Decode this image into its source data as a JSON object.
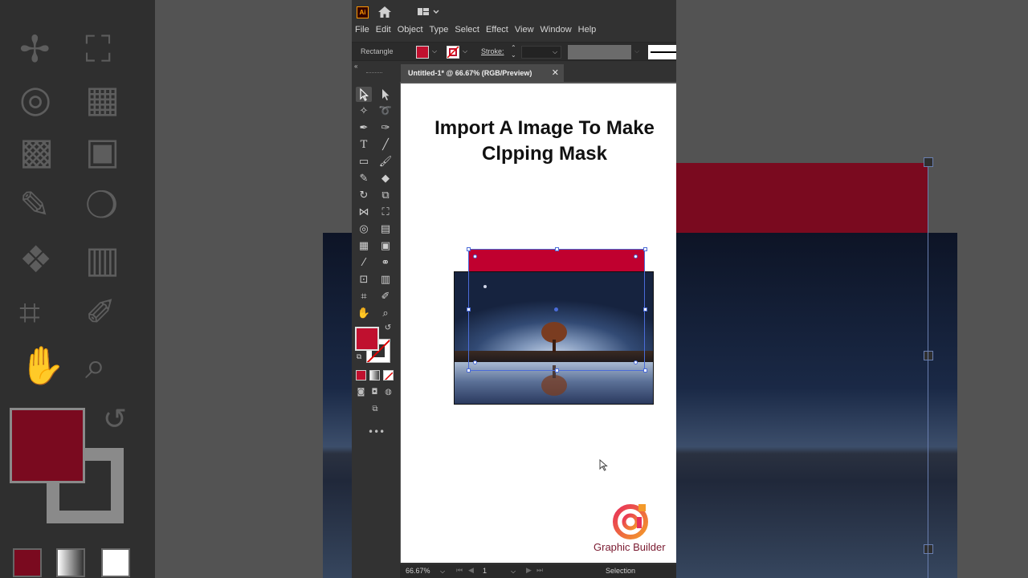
{
  "app": {
    "logo_text": "Ai",
    "menus": [
      "File",
      "Edit",
      "Object",
      "Type",
      "Select",
      "Effect",
      "View",
      "Window",
      "Help"
    ]
  },
  "control_bar": {
    "object_type": "Rectangle",
    "stroke_label": "Stroke:",
    "fill_color": "#c0102f"
  },
  "document": {
    "tab_title": "Untitled-1* @ 66.67% (RGB/Preview)",
    "close_glyph": "✕"
  },
  "artboard": {
    "title_line1": "Import A Image To Make",
    "title_line2": "Clpping Mask",
    "brand": "Graphic Builder"
  },
  "status": {
    "zoom": "66.67%",
    "page": "1",
    "tool": "Selection"
  },
  "colors": {
    "accent_red": "#c0002f",
    "selection_blue": "#4a6bd8"
  }
}
